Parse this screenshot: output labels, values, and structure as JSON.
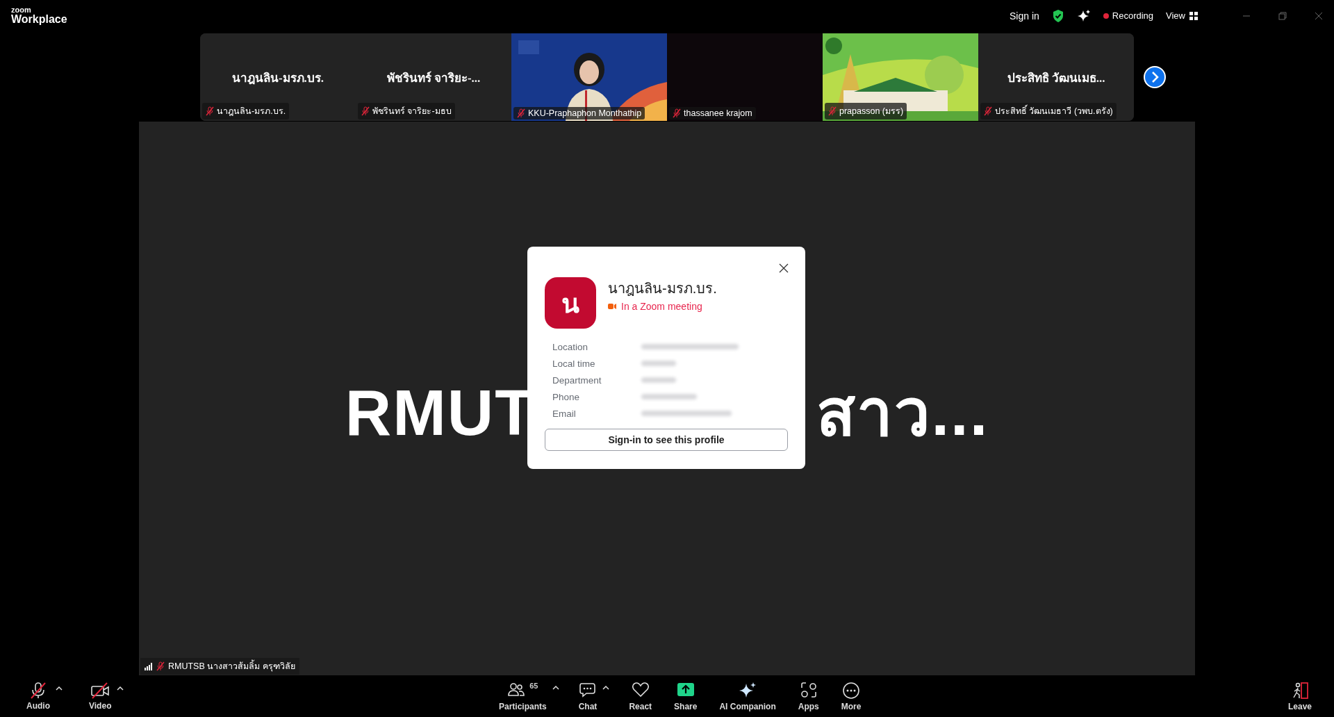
{
  "top_bar": {
    "logo_top": "zoom",
    "logo_bottom": "Workplace",
    "sign_in": "Sign in",
    "recording": "Recording",
    "view": "View"
  },
  "thumbnails": [
    {
      "kind": "name",
      "display": "นาฎนลิน-มรภ.บร.",
      "label": "นาฎนลิน-มรภ.บร.",
      "muted": true
    },
    {
      "kind": "name",
      "display": "พัชรินทร์ จาริยะ-...",
      "label": "พัชรินทร์ จาริยะ-มธบ",
      "muted": true
    },
    {
      "kind": "picture",
      "label": "KKU-Praphaphon Monthathip",
      "muted": true
    },
    {
      "kind": "blank",
      "label": "thassanee krajom",
      "muted": true
    },
    {
      "kind": "picture",
      "label": "prapasson (มรร)",
      "muted": true
    },
    {
      "kind": "name",
      "display": "ประสิทธิ วัฒนเมธ...",
      "label": "ประสิทธิ์ วัฒนเมธาวี (วพบ.ตรัง)",
      "muted": true
    }
  ],
  "share": {
    "text_left": "RMUT",
    "text_right": "สาว...",
    "presenter": "RMUTSB นางสาวส้มลิ้ม ครุฑวิลัย",
    "presenter_muted": true
  },
  "profile_card": {
    "avatar": "น",
    "name": "นาฎนลิน-มรภ.บร.",
    "status": "In a Zoom meeting",
    "fields": [
      "Location",
      "Local time",
      "Department",
      "Phone",
      "Email"
    ],
    "button": "Sign-in to see this profile"
  },
  "toolbar": {
    "left": [
      {
        "kind": "audio",
        "label": "Audio",
        "off": true
      },
      {
        "kind": "video",
        "label": "Video",
        "off": true
      }
    ],
    "center": [
      {
        "kind": "participants",
        "label": "Participants",
        "count": "65",
        "caret": true
      },
      {
        "kind": "chat",
        "label": "Chat",
        "caret": true
      },
      {
        "kind": "react",
        "label": "React",
        "caret": false
      },
      {
        "kind": "share",
        "label": "Share",
        "caret": false
      },
      {
        "kind": "ai",
        "label": "AI Companion",
        "caret": false
      },
      {
        "kind": "apps",
        "label": "Apps",
        "caret": false
      },
      {
        "kind": "more",
        "label": "More",
        "caret": false
      }
    ],
    "leave": "Leave"
  }
}
